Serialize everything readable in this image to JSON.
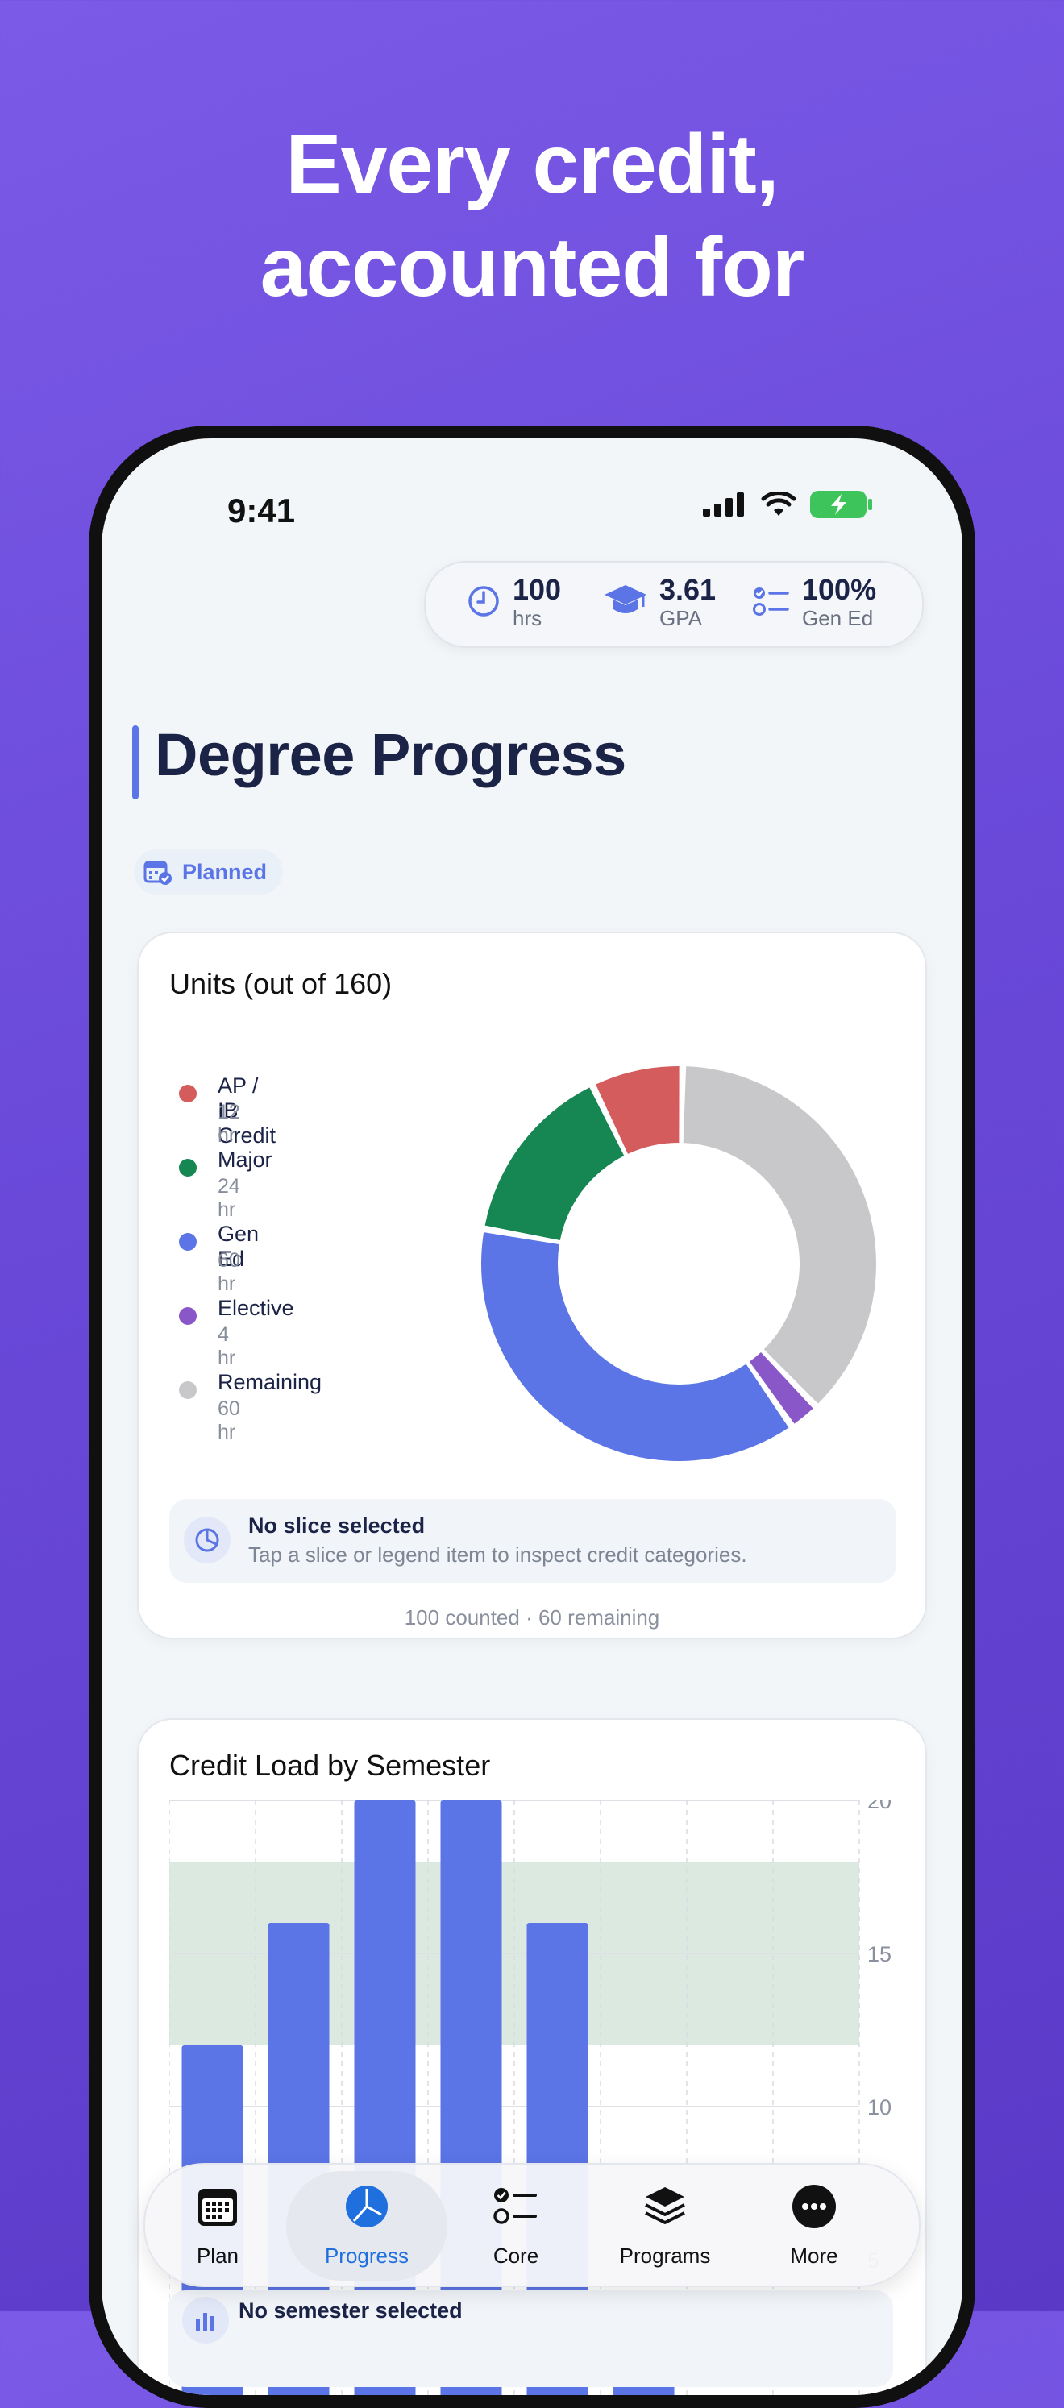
{
  "headline": {
    "line1": "Every credit,",
    "line2": "accounted for"
  },
  "status": {
    "time": "9:41"
  },
  "stats": [
    {
      "value": "100",
      "label": "hrs",
      "icon": "clock-icon"
    },
    {
      "value": "3.61",
      "label": "GPA",
      "icon": "graduation-cap-icon"
    },
    {
      "value": "100%",
      "label": "Gen Ed",
      "icon": "checklist-icon"
    }
  ],
  "page": {
    "title": "Degree Progress",
    "chip": "Planned"
  },
  "units_card": {
    "title": "Units (out of 160)",
    "legend": [
      {
        "name": "AP / IB Credit",
        "value": "12 hr",
        "color": "#d45c5c"
      },
      {
        "name": "Major",
        "value": "24 hr",
        "color": "#168652"
      },
      {
        "name": "Gen Ed",
        "value": "60 hr",
        "color": "#5b74e6"
      },
      {
        "name": "Elective",
        "value": "4 hr",
        "color": "#8a57c8"
      },
      {
        "name": "Remaining",
        "value": "60 hr",
        "color": "#c8c8ca"
      }
    ],
    "selection_title": "No slice selected",
    "selection_hint": "Tap a slice or legend item to inspect credit categories.",
    "footer": "100 counted · 60 remaining"
  },
  "chart_data": [
    {
      "type": "pie",
      "title": "Units (out of 160)",
      "categories": [
        "AP / IB Credit",
        "Major",
        "Gen Ed",
        "Elective",
        "Remaining"
      ],
      "values": [
        12,
        24,
        60,
        4,
        60
      ],
      "colors": [
        "#d45c5c",
        "#168652",
        "#5b74e6",
        "#8a57c8",
        "#c8c8ca"
      ]
    },
    {
      "type": "bar",
      "title": "Credit Load by Semester",
      "values": [
        12,
        16,
        20,
        20,
        16,
        4,
        0,
        0
      ],
      "y_ticks": [
        "5",
        "10",
        "15",
        "20"
      ],
      "ylim": [
        0,
        20
      ],
      "target_band": [
        12,
        18
      ],
      "grid": true,
      "bar_color": "#5b74e6"
    }
  ],
  "load_card": {
    "title": "Credit Load by Semester",
    "selection_title": "No semester selected"
  },
  "tabs": [
    {
      "label": "Plan",
      "icon": "calendar-icon"
    },
    {
      "label": "Progress",
      "icon": "pie-chart-icon",
      "active": true
    },
    {
      "label": "Core",
      "icon": "checklist-icon"
    },
    {
      "label": "Programs",
      "icon": "layers-icon"
    },
    {
      "label": "More",
      "icon": "more-icon"
    }
  ]
}
